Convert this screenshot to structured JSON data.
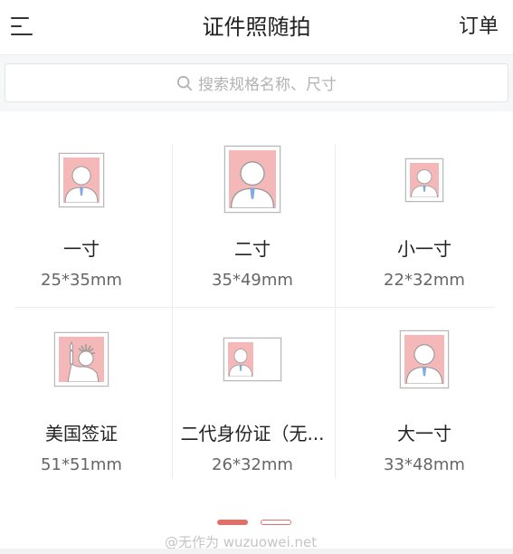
{
  "header": {
    "title": "证件照随拍",
    "orders_label": "订单"
  },
  "search": {
    "placeholder": "搜索规格名称、尺寸"
  },
  "specs": [
    {
      "name": "一寸",
      "size": "25*35mm",
      "icon": "portrait-icon"
    },
    {
      "name": "二寸",
      "size": "35*49mm",
      "icon": "portrait-icon"
    },
    {
      "name": "小一寸",
      "size": "22*32mm",
      "icon": "portrait-icon"
    },
    {
      "name": "美国签证",
      "size": "51*51mm",
      "icon": "statue-of-liberty-icon"
    },
    {
      "name": "二代身份证（无...",
      "size": "26*32mm",
      "icon": "portrait-icon"
    },
    {
      "name": "大一寸",
      "size": "33*48mm",
      "icon": "portrait-icon"
    }
  ],
  "pager": {
    "pages": 2,
    "active": 1
  },
  "watermark": "@无作为 wuzuowei.net",
  "colors": {
    "accent": "#e0706c",
    "photo_bg": "#f5b8b8"
  }
}
